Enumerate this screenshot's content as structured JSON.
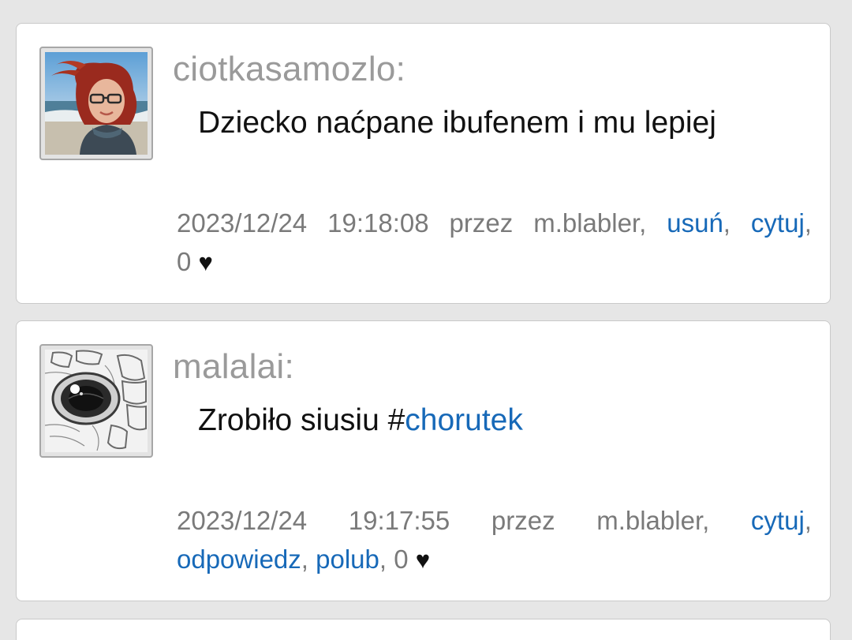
{
  "posts": [
    {
      "username": "ciotkasamozlo:",
      "avatar": "avatar-woman-red-hair",
      "message": "Dziecko naćpane ibufenem i mu lepiej",
      "meta": {
        "date": "2023/12/24",
        "time": "19:18:08",
        "by": "przez",
        "author": "m.blabler,",
        "actions": [
          "usuń",
          "cytuj"
        ],
        "likes": "0",
        "heart": "♥"
      }
    },
    {
      "username": "malalai:",
      "avatar": "avatar-eye-drawing",
      "message_prefix": "Zrobiło siusiu #",
      "message_tag": "chorutek",
      "meta": {
        "date": "2023/12/24",
        "time": "19:17:55",
        "by": "przez",
        "author": "m.blabler,",
        "actions": [
          "cytuj",
          "odpowiedz",
          "polub"
        ],
        "likes": "0",
        "heart": "♥"
      }
    }
  ],
  "colors": {
    "background": "#e6e6e6",
    "card": "#ffffff",
    "link": "#1769b8",
    "username": "#9a9a9a",
    "meta": "#7a7a7a"
  }
}
